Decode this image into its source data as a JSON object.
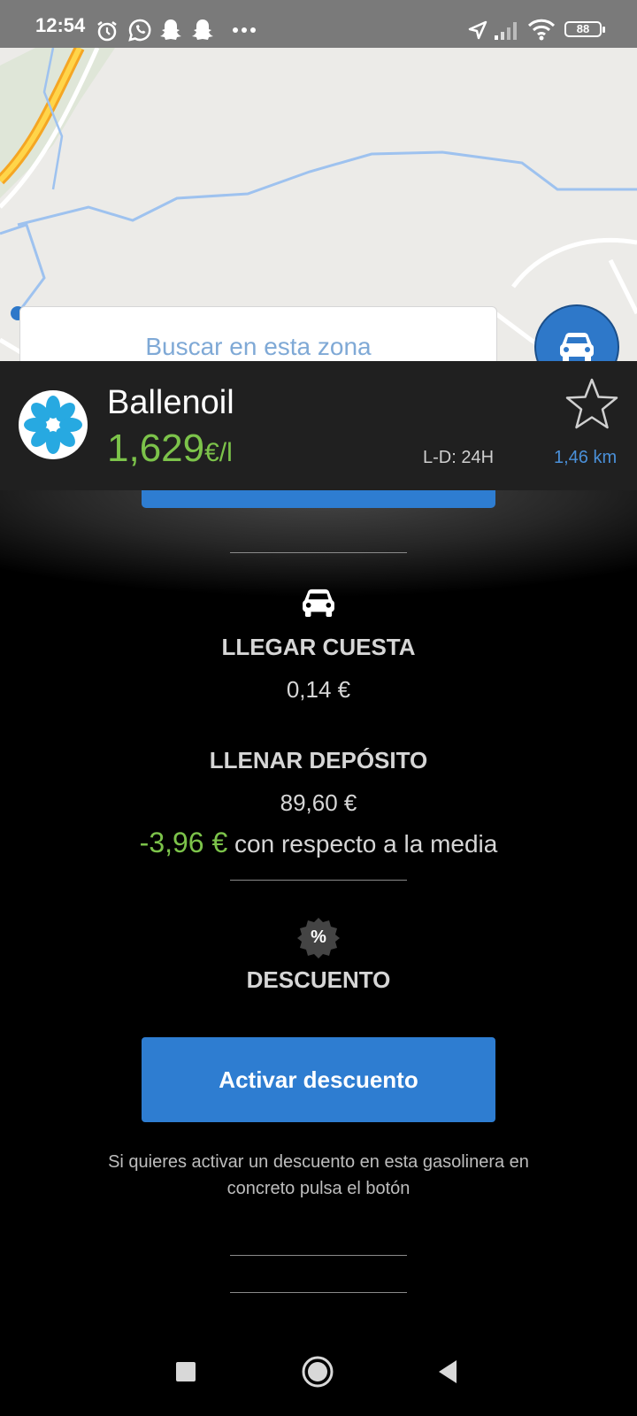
{
  "status_bar": {
    "time": "12:54",
    "battery": "88",
    "icons": [
      "alarm-icon",
      "whatsapp-icon",
      "snapchat-icon",
      "snapchat-icon",
      "more-dots-icon",
      "location-arrow-icon",
      "signal-icon",
      "wifi-icon",
      "battery-icon"
    ]
  },
  "map": {
    "search_placeholder": "Buscar en esta zona",
    "fab_icon": "car-icon"
  },
  "station": {
    "name": "Ballenoil",
    "price": "1,629",
    "price_unit": "€/l",
    "hours": "L-D: 24H",
    "distance": "1,46 km",
    "favorite_icon": "star-outline-icon"
  },
  "details": {
    "travel_heading": "LLEGAR CUESTA",
    "travel_cost": "0,14 €",
    "fill_heading": "LLENAR DEPÓSITO",
    "fill_cost": "89,60 €",
    "savings_value": "-3,96 €",
    "savings_text": " con respecto a la media",
    "discount_heading": "DESCUENTO",
    "discount_badge": "%",
    "activate_button": "Activar descuento",
    "hint": "Si quieres activar un descuento en esta gasolinera en concreto pulsa el botón"
  },
  "colors": {
    "accent_blue": "#2e7dd1",
    "price_green": "#7cc34a",
    "header_bg": "#202020"
  },
  "nav_bar": {
    "icons": [
      "recents-square-icon",
      "home-circle-icon",
      "back-triangle-icon"
    ]
  }
}
